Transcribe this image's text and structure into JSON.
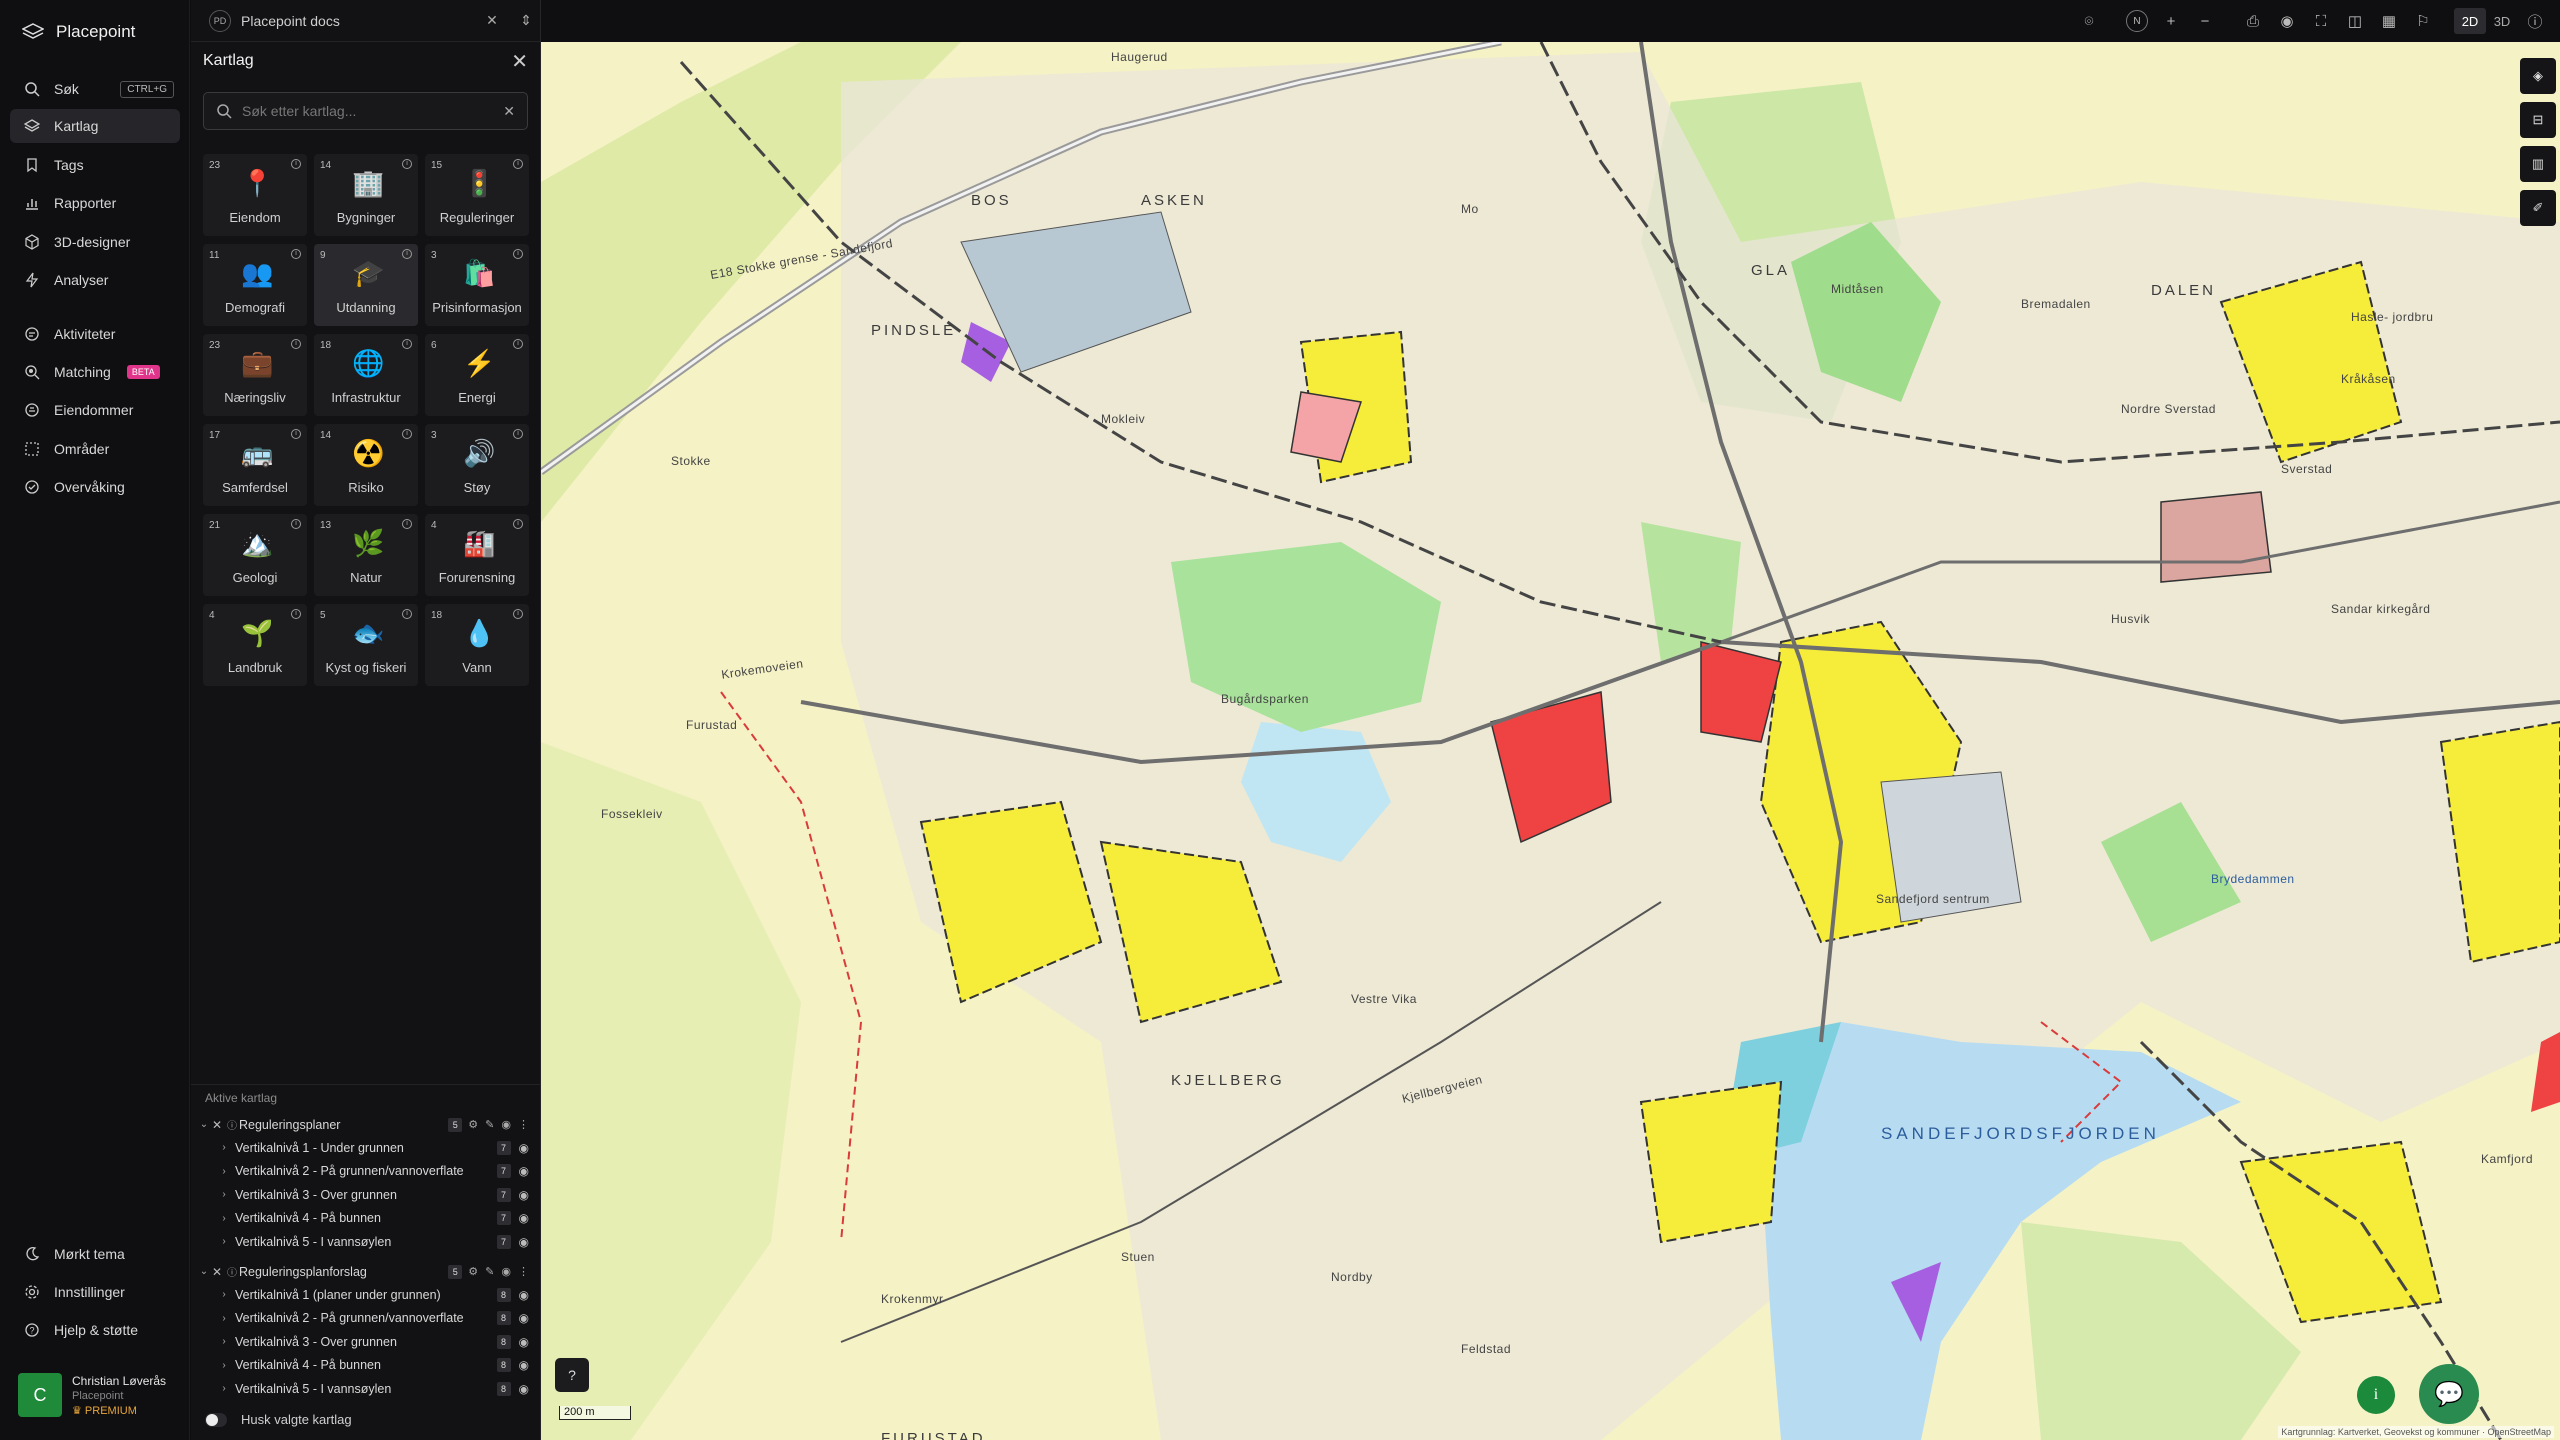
{
  "app": {
    "name": "Placepoint"
  },
  "nav": {
    "items": [
      {
        "label": "Søk",
        "shortcut": "CTRL+G"
      },
      {
        "label": "Kartlag"
      },
      {
        "label": "Tags"
      },
      {
        "label": "Rapporter"
      },
      {
        "label": "3D-designer"
      },
      {
        "label": "Analyser"
      },
      {
        "label": "Aktiviteter"
      },
      {
        "label": "Matching",
        "badge": "BETA"
      },
      {
        "label": "Eiendommer"
      },
      {
        "label": "Områder"
      },
      {
        "label": "Overvåking"
      }
    ],
    "bottom": [
      {
        "label": "Mørkt tema"
      },
      {
        "label": "Innstillinger"
      },
      {
        "label": "Hjelp & støtte"
      }
    ],
    "user": {
      "initial": "C",
      "name": "Christian Løverås",
      "org": "Placepoint",
      "plan": "PREMIUM"
    }
  },
  "workspace": {
    "badge": "PD",
    "name": "Placepoint docs"
  },
  "panel": {
    "title": "Kartlag",
    "search_placeholder": "Søk etter kartlag...",
    "categories": [
      {
        "count": "23",
        "label": "Eiendom",
        "icon": "📍"
      },
      {
        "count": "14",
        "label": "Bygninger",
        "icon": "🏢"
      },
      {
        "count": "15",
        "label": "Reguleringer",
        "icon": "🚦"
      },
      {
        "count": "11",
        "label": "Demografi",
        "icon": "👥"
      },
      {
        "count": "9",
        "label": "Utdanning",
        "icon": "🎓"
      },
      {
        "count": "3",
        "label": "Prisinformasjon",
        "icon": "🛍️"
      },
      {
        "count": "23",
        "label": "Næringsliv",
        "icon": "💼"
      },
      {
        "count": "18",
        "label": "Infrastruktur",
        "icon": "🌐"
      },
      {
        "count": "6",
        "label": "Energi",
        "icon": "⚡"
      },
      {
        "count": "17",
        "label": "Samferdsel",
        "icon": "🚌"
      },
      {
        "count": "14",
        "label": "Risiko",
        "icon": "☢️"
      },
      {
        "count": "3",
        "label": "Støy",
        "icon": "🔊"
      },
      {
        "count": "21",
        "label": "Geologi",
        "icon": "🏔️"
      },
      {
        "count": "13",
        "label": "Natur",
        "icon": "🌿"
      },
      {
        "count": "4",
        "label": "Forurensning",
        "icon": "🏭"
      },
      {
        "count": "4",
        "label": "Landbruk",
        "icon": "🌱"
      },
      {
        "count": "5",
        "label": "Kyst og fiskeri",
        "icon": "🐟"
      },
      {
        "count": "18",
        "label": "Vann",
        "icon": "💧"
      }
    ],
    "active_title": "Aktive kartlag",
    "groups": [
      {
        "name": "Reguleringsplaner",
        "count": "5",
        "items": [
          {
            "name": "Vertikalnivå 1 - Under grunnen",
            "count": "7"
          },
          {
            "name": "Vertikalnivå 2 - På grunnen/vannoverflate",
            "count": "7"
          },
          {
            "name": "Vertikalnivå 3 - Over grunnen",
            "count": "7"
          },
          {
            "name": "Vertikalnivå 4 - På bunnen",
            "count": "7"
          },
          {
            "name": "Vertikalnivå 5 - I vannsøylen",
            "count": "7"
          }
        ]
      },
      {
        "name": "Reguleringsplanforslag",
        "count": "5",
        "items": [
          {
            "name": "Vertikalnivå 1 (planer under grunnen)",
            "count": "8"
          },
          {
            "name": "Vertikalnivå 2 - På grunnen/vannoverflate",
            "count": "8"
          },
          {
            "name": "Vertikalnivå 3 - Over grunnen",
            "count": "8"
          },
          {
            "name": "Vertikalnivå 4 - På bunnen",
            "count": "8"
          },
          {
            "name": "Vertikalnivå 5 - I vannsøylen",
            "count": "8"
          }
        ]
      }
    ],
    "remember_label": "Husk valgte kartlag"
  },
  "toolbar": {
    "compass": "N",
    "mode_2d": "2D",
    "mode_3d": "3D"
  },
  "map": {
    "labels": [
      "Haugerud",
      "BOS",
      "ASKEN",
      "PINDSLE",
      "Mo",
      "GLA",
      "DALEN",
      "Midtåsen",
      "Husvik",
      "Stokke",
      "Furustad",
      "Fossekleiv",
      "Nordre Sverstad",
      "Sverstad",
      "Kråkåsen",
      "Sandar kirkegård",
      "KJELLBERG",
      "SANDEFJORDSFJORDEN",
      "Brydedammen",
      "FURUSTAD",
      "E18 Stokke grense - Sandefjord",
      "Mokleiv",
      "Bugårdsparken",
      "Sandefjord sentrum",
      "Vestre Vika",
      "Kjellbergveien",
      "Krokemoveien",
      "Hasle- jordbru",
      "Bremadalen",
      "Feldstad",
      "Kamfjord",
      "Krokenmyr",
      "Nordby",
      "Stuen"
    ],
    "scale": "200 m",
    "attribution": "Kartgrunnlag: Kartverket, Geovekst og kommuner · OpenStreetMap"
  }
}
